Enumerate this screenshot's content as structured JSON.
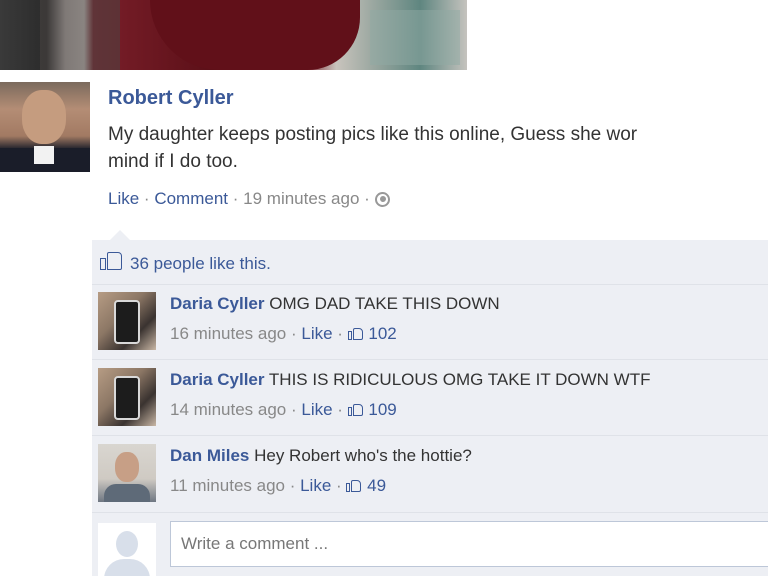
{
  "post": {
    "author": "Robert Cyller",
    "text_line1": "My daughter keeps posting pics like this online, Guess she wor",
    "text_line2": "mind if I do too.",
    "like_label": "Like",
    "comment_label": "Comment",
    "timestamp": "19 minutes ago",
    "sep": "·"
  },
  "likes_summary": "36 people like this.",
  "comments": [
    {
      "author": "Daria Cyller",
      "text": "OMG DAD TAKE THIS DOWN",
      "time": "16 minutes ago",
      "like_label": "Like",
      "likes": "102"
    },
    {
      "author": "Daria Cyller",
      "text": "THIS IS RIDICULOUS OMG TAKE IT DOWN WTF",
      "time": "14 minutes ago",
      "like_label": "Like",
      "likes": "109"
    },
    {
      "author": "Dan Miles",
      "text": "Hey Robert who's the hottie?",
      "time": "11 minutes ago",
      "like_label": "Like",
      "likes": "49"
    }
  ],
  "reply": {
    "placeholder": "Write a comment ..."
  },
  "colors": {
    "link": "#3b5998",
    "ufi_background": "#edeff4",
    "meta_text": "#888888"
  },
  "icons": [
    "globe-icon",
    "thumbs-up-icon",
    "default-avatar-icon"
  ]
}
